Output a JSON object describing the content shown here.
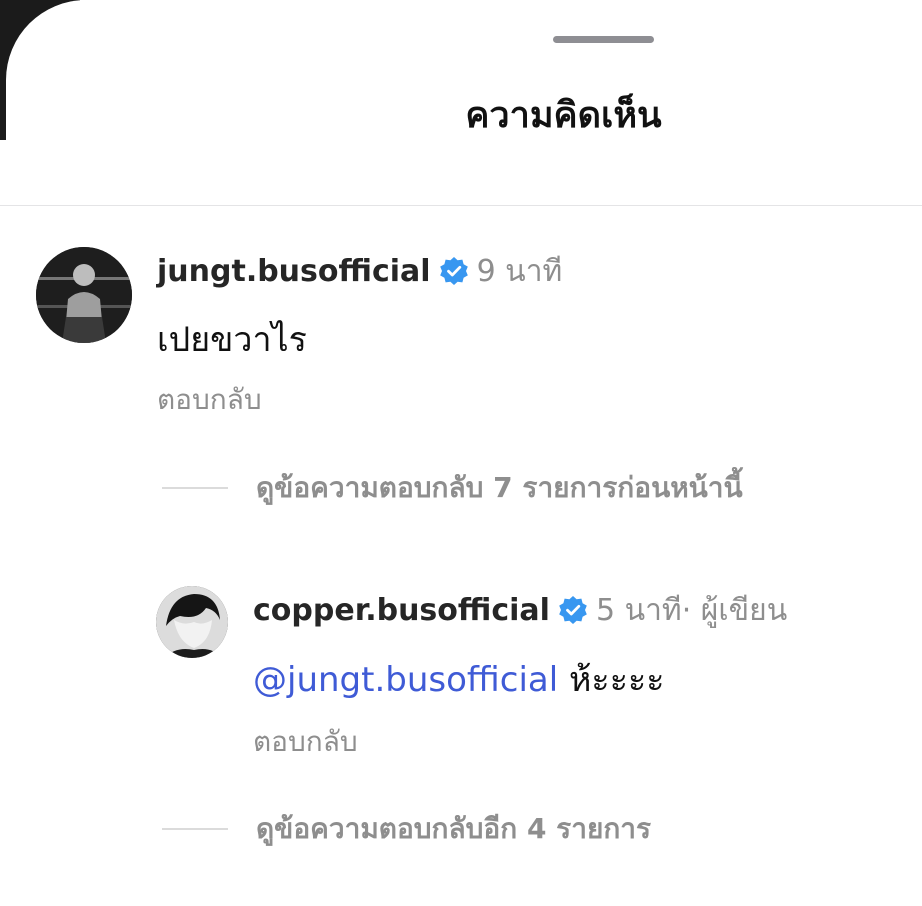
{
  "sheet": {
    "title": "ความคิดเห็น"
  },
  "comments": [
    {
      "username": "jungt.busofficial",
      "time": "9 นาที",
      "text": "เปยขวาไร",
      "reply_label": "ตอบกลับ",
      "view_replies": "ดูข้อความตอบกลับ 7 รายการก่อนหน้านี้"
    }
  ],
  "replies": [
    {
      "username": "copper.busofficial",
      "time": "5 นาที",
      "author_tag": " · ผู้เขียน",
      "mention": "@jungt.busofficial",
      "text": "ห้ะะะะ",
      "reply_label": "ตอบกลับ",
      "view_replies": "ดูข้อความตอบกลับอีก 4 รายการ"
    }
  ],
  "colors": {
    "verified": "#3897f0",
    "mention": "#3f5bd6",
    "secondary_text": "#8e8e8e"
  }
}
